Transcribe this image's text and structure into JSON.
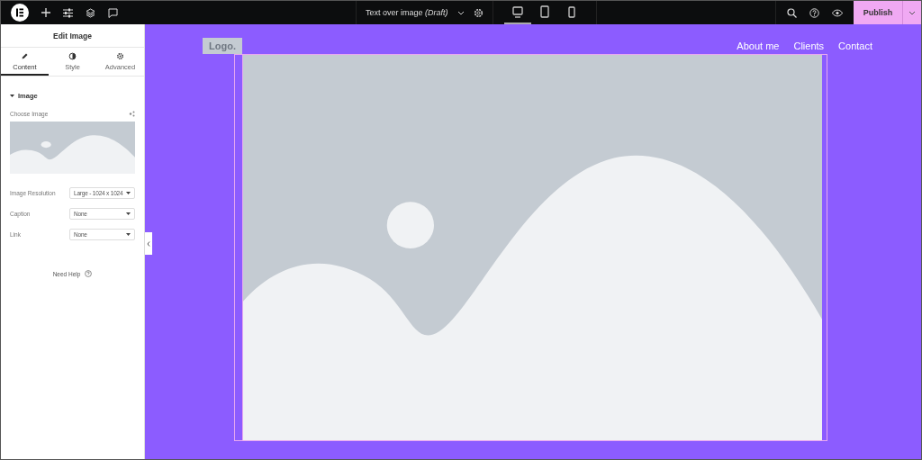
{
  "topbar": {
    "document_title": "Text over image",
    "document_status": "(Draft)",
    "devices": [
      {
        "kind": "desktop",
        "selected": true
      },
      {
        "kind": "tablet",
        "selected": false
      },
      {
        "kind": "mobile",
        "selected": false
      }
    ],
    "publish": "Publish"
  },
  "panel": {
    "title": "Edit Image",
    "tabs": [
      {
        "label": "Content",
        "kind": "pencil",
        "selected": true
      },
      {
        "label": "Style",
        "kind": "contrast",
        "selected": false
      },
      {
        "label": "Advanced",
        "kind": "gear",
        "selected": false
      }
    ],
    "section": {
      "title": "Image",
      "expanded": true
    },
    "choose_image_label": "Choose Image",
    "fields": [
      {
        "label": "Image Resolution",
        "value": "Large - 1024 x 1024"
      },
      {
        "label": "Caption",
        "value": "None"
      },
      {
        "label": "Link",
        "value": "None"
      }
    ],
    "help": "Need Help"
  },
  "canvas": {
    "logo": "Logo.",
    "nav": [
      "About me",
      "Clients",
      "Contact"
    ]
  }
}
